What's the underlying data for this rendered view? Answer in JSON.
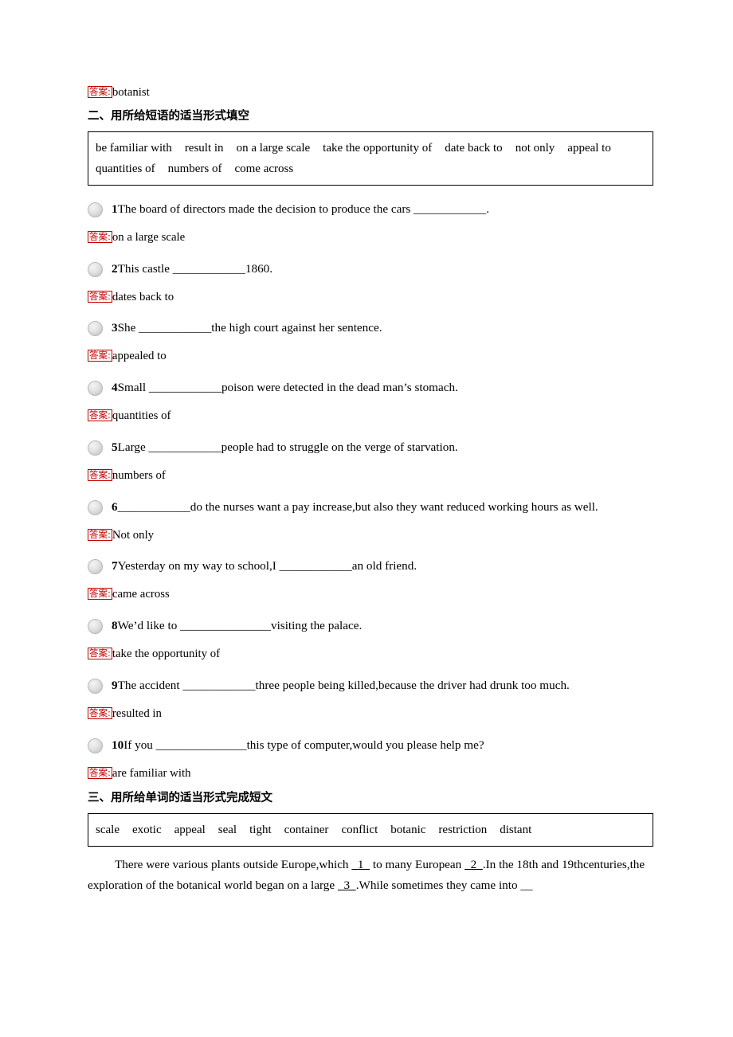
{
  "answer_tag": "答案:",
  "top_answer": "botanist",
  "section2": {
    "heading": "二、用所给短语的适当形式填空",
    "wordbank": {
      "row1": [
        "be familiar with",
        "result in",
        "on a large scale",
        "take the opportunity of",
        "date back to",
        "not only",
        "appeal to"
      ],
      "row2": [
        "quantities of",
        "numbers of",
        "come across"
      ]
    },
    "questions": [
      {
        "num": "1",
        "text": "The board of directors made the decision to produce the cars ____________.",
        "answer": "on a large scale"
      },
      {
        "num": "2",
        "text": "This castle ____________1860.",
        "answer": "dates back to"
      },
      {
        "num": "3",
        "text": "She ____________the high court against her sentence.",
        "answer": "appealed to"
      },
      {
        "num": "4",
        "text": "Small ____________poison were detected in the dead man’s stomach.",
        "answer": "quantities of"
      },
      {
        "num": "5",
        "text": "Large ____________people had to struggle on the verge of starvation.",
        "answer": "numbers of"
      },
      {
        "num": "6",
        "text": "____________do the nurses want a pay increase,but also they want reduced working hours as well.",
        "answer": "Not only"
      },
      {
        "num": "7",
        "text": "Yesterday on my way to school,I ____________an old friend.",
        "answer": "came across"
      },
      {
        "num": "8",
        "text": "We’d like to _______________visiting the palace.",
        "answer": "take the opportunity of"
      },
      {
        "num": "9",
        "text": "The accident ____________three people being killed,because the driver had drunk too much.",
        "answer": "resulted in"
      },
      {
        "num": "10",
        "text": "If you _______________this type of computer,would you please help me?",
        "answer": "are familiar with"
      }
    ]
  },
  "section3": {
    "heading": "三、用所给单词的适当形式完成短文",
    "wordbank": [
      "scale",
      "exotic",
      "appeal",
      "seal",
      "tight",
      "container",
      "conflict",
      "botanic",
      "restriction",
      "distant"
    ],
    "passage_line1_a": "There were various plants outside Europe,which ",
    "passage_blank1": "  1  ",
    "passage_line1_b": " to many European ",
    "passage_blank2": "  2  ",
    "passage_line1_c": ".In the 18th and 19th",
    "passage_line2_a": "centuries,the exploration of the botanical world began on a large ",
    "passage_blank3": "  3  ",
    "passage_line2_b": ".While sometimes they came into __"
  },
  "colors": {
    "answer_red": "#c00000",
    "text_black": "#000000",
    "border_black": "#000000"
  }
}
